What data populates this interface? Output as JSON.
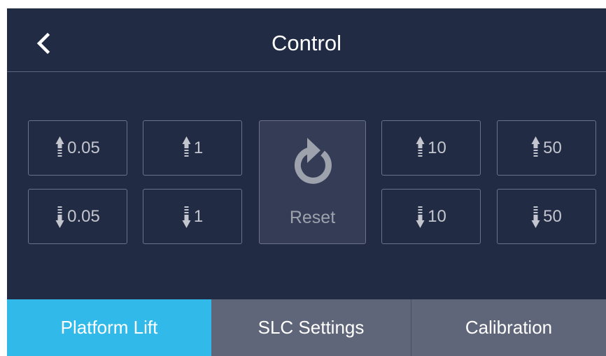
{
  "header": {
    "title": "Control",
    "back_icon": "chevron-left-icon"
  },
  "controls": {
    "up": [
      {
        "label": "0.05",
        "icon": "arrow-up-icon"
      },
      {
        "label": "1",
        "icon": "arrow-up-icon"
      },
      {
        "label": "10",
        "icon": "arrow-up-icon"
      },
      {
        "label": "50",
        "icon": "arrow-up-icon"
      }
    ],
    "down": [
      {
        "label": "0.05",
        "icon": "arrow-down-icon"
      },
      {
        "label": "1",
        "icon": "arrow-down-icon"
      },
      {
        "label": "10",
        "icon": "arrow-down-icon"
      },
      {
        "label": "50",
        "icon": "arrow-down-icon"
      }
    ],
    "reset": {
      "label": "Reset",
      "icon": "reset-icon"
    }
  },
  "tabs": [
    {
      "label": "Platform Lift",
      "active": true
    },
    {
      "label": "SLC Settings",
      "active": false
    },
    {
      "label": "Calibration",
      "active": false
    }
  ],
  "colors": {
    "background": "#222b44",
    "accent": "#30b9e9",
    "tab_inactive": "#5f6679",
    "border": "#6b728a"
  }
}
